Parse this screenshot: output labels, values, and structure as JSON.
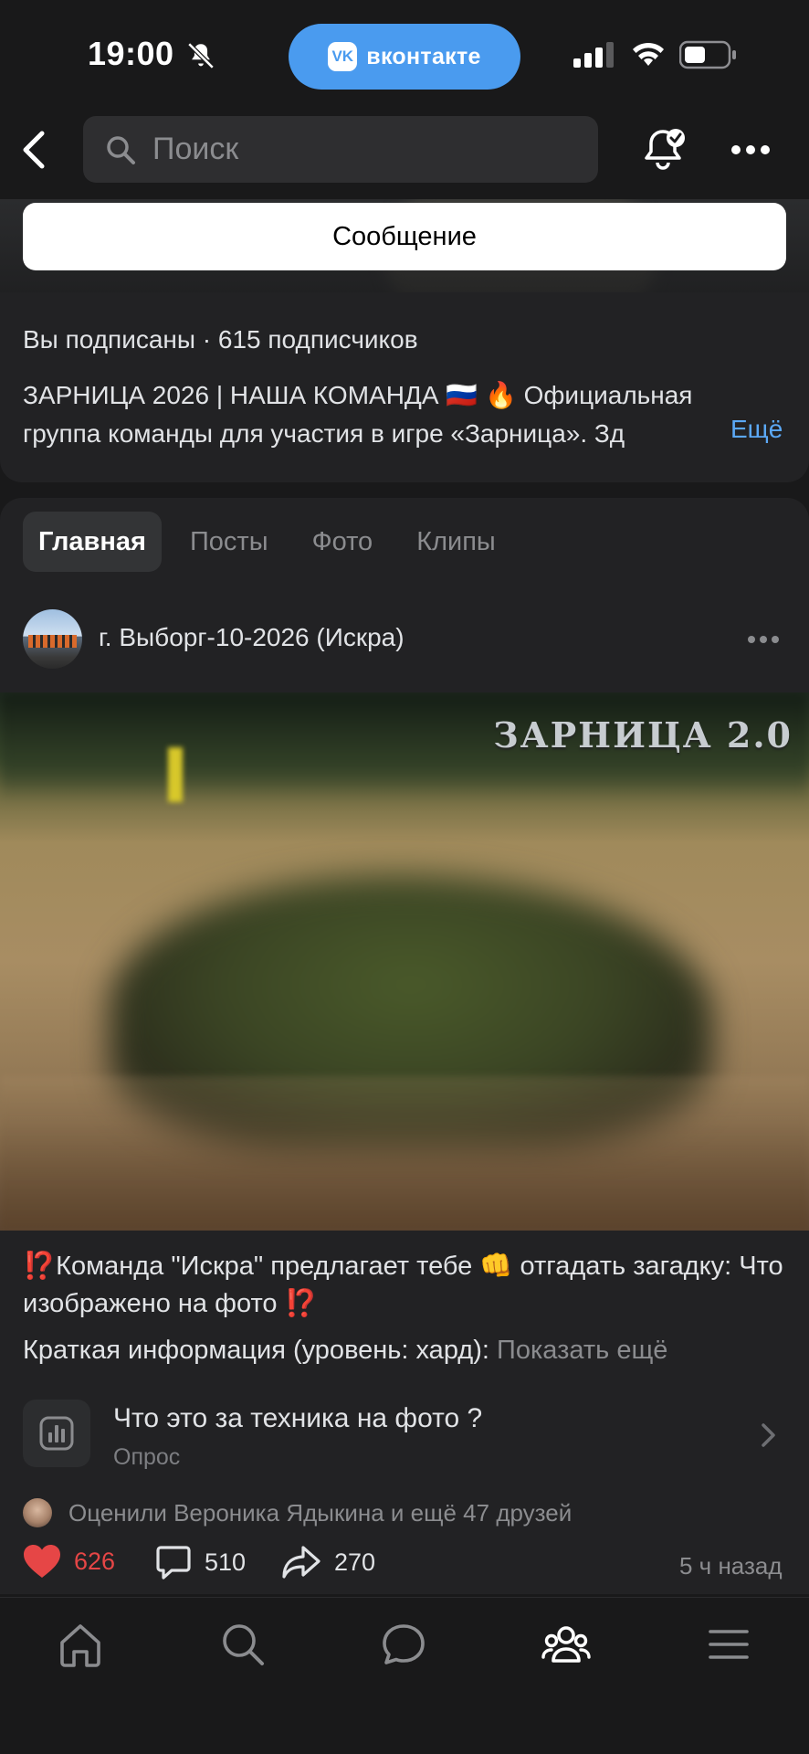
{
  "status_bar": {
    "time": "19:00",
    "vk_label": "вконтакте",
    "vk_logo": "VK",
    "icons": [
      "bell-off-icon",
      "signal-icon",
      "wifi-icon",
      "battery-icon"
    ]
  },
  "nav": {
    "search_placeholder": "Поиск",
    "icons": [
      "back-icon",
      "search-icon",
      "bell-check-icon",
      "more-icon"
    ]
  },
  "group": {
    "message_button": "Сообщение",
    "subscribed_text": "Вы подписаны · ",
    "subscribers": "615 подписчиков",
    "description_line1": "ЗАРНИЦА 2026 | НАША КОМАНДА 🇷🇺 🔥 Официальная",
    "description_line2": "группа команды для участия в игре «Зарница». Зд",
    "more_link": "Ещё"
  },
  "tabs": [
    {
      "label": "Главная",
      "active": true
    },
    {
      "label": "Посты",
      "active": false
    },
    {
      "label": "Фото",
      "active": false
    },
    {
      "label": "Клипы",
      "active": false
    }
  ],
  "post": {
    "author": "г. Выборг-10-2026 (Искра)",
    "image_label": "ЗАРНИЦА 2.0",
    "text": "⁉️Команда \"Искра\" предлагает тебе 👊 отгадать загадку: Что изображено на фото ⁉️",
    "text2": "Краткая информация (уровень: хард): ",
    "show_more": "Показать ещё",
    "poll": {
      "title": "Что это за техника на фото ?",
      "subtitle": "Опрос"
    },
    "liked_by": "Оценили Вероника Ядыкина и ещё 47 друзей",
    "likes": "626",
    "comments": "510",
    "shares": "270",
    "time_ago": "5 ч назад"
  },
  "tabbar": {
    "icons": [
      "home-icon",
      "search-icon",
      "messages-icon",
      "community-icon",
      "menu-icon"
    ],
    "active": "community-icon"
  },
  "colors": {
    "background": "#19191a",
    "card": "#222224",
    "accent": "#4a9bef",
    "link": "#5ba8f5",
    "like": "#e64646"
  }
}
